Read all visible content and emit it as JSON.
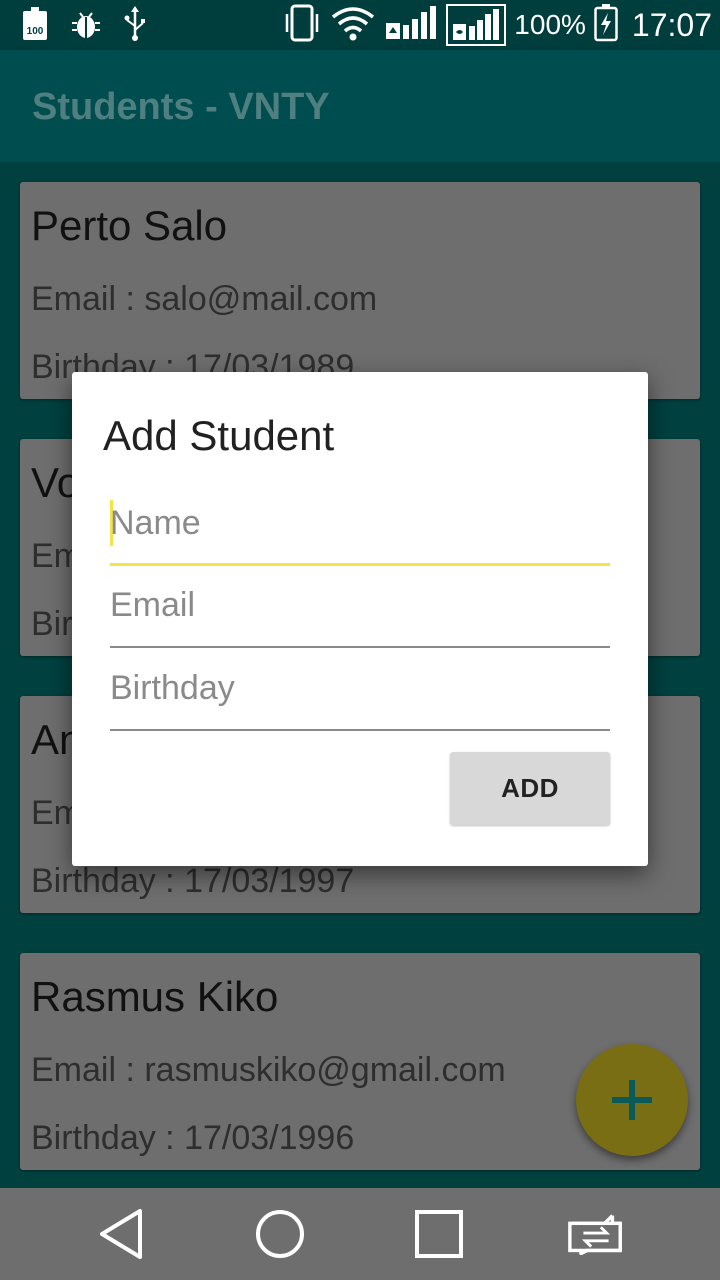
{
  "status_bar": {
    "battery_percent": "100%",
    "time": "17:07",
    "left_icons": [
      "battery-100-icon",
      "debug-bug-icon",
      "usb-icon"
    ],
    "right_icons": [
      "vibrate-icon",
      "wifi-icon",
      "signal-sim1-icon",
      "signal-sim2-icon",
      "charging-battery-icon"
    ]
  },
  "app_bar": {
    "title": "Students - VNTY"
  },
  "students": [
    {
      "name": "Perto Salo",
      "email": "Email : salo@mail.com",
      "birthday": "Birthday : 17/03/1989"
    },
    {
      "name": "Vo",
      "email": "Em",
      "birthday": "Bir"
    },
    {
      "name": "An",
      "email": "Em",
      "birthday": "Birthday : 17/03/1997"
    },
    {
      "name": "Rasmus Kiko",
      "email": "Email : rasmuskiko@gmail.com",
      "birthday": "Birthday : 17/03/1996"
    }
  ],
  "dialog": {
    "title": "Add Student",
    "name_placeholder": "Name",
    "email_placeholder": "Email",
    "birthday_placeholder": "Birthday",
    "add_label": "ADD"
  },
  "fab": {
    "icon": "plus-icon"
  },
  "nav_bar": {
    "icons": [
      "back-icon",
      "home-icon",
      "recents-icon",
      "switch-icon"
    ]
  },
  "colors": {
    "accent": "#f2e54a",
    "primary_dark": "#003d3d",
    "app_bar": "#004d50"
  }
}
